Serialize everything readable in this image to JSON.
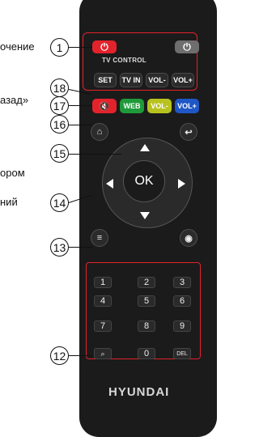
{
  "callouts": {
    "c1": "1",
    "c18": "18",
    "c17": "17",
    "c16": "16",
    "c15": "15",
    "c14": "14",
    "c13": "13",
    "c12": "12"
  },
  "left_text": {
    "l1": "очение",
    "l2": "азад»",
    "l3": "ором",
    "l4": "ний"
  },
  "remote": {
    "tv_control": "TV CONTROL",
    "set": "SET",
    "tv_in": "TV IN",
    "vol_minus": "VOL-",
    "vol_plus": "VOL+",
    "web": "WEB",
    "vol_minus_2": "VOL-",
    "vol_plus_2": "VOL+",
    "ok": "OK",
    "digits": [
      "1",
      "2",
      "3",
      "4",
      "5",
      "6",
      "7",
      "8",
      "9"
    ],
    "zero": "0",
    "del": "DEL",
    "brand": "HYUNDAI"
  },
  "colors": {
    "power": "#e3232c",
    "web": "#1f9a3a",
    "vol_minus": "#b7c21e",
    "vol_plus": "#1f57c6",
    "mute": "#e3232c",
    "frame": "#e3232c"
  }
}
